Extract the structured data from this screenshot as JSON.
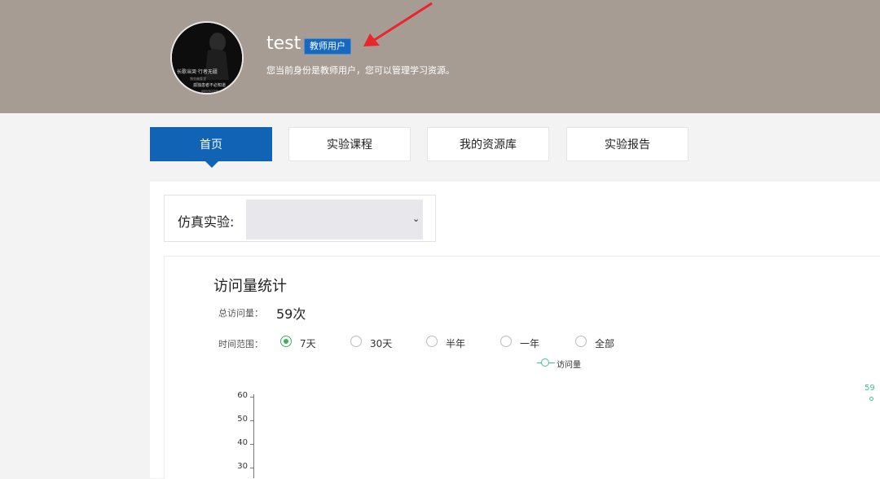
{
  "header": {
    "username": "test",
    "role_badge": "教师用户",
    "role_description": "您当前身份是教师用户，您可以管理学习资源。",
    "avatar_lines": [
      "长歌当哭·行者无疆",
      "独坐幽篁里",
      "孤独患者不必知道",
      "但愿长醉不复醒"
    ]
  },
  "tabs": [
    {
      "label": "首页",
      "active": true
    },
    {
      "label": "实验课程",
      "active": false
    },
    {
      "label": "我的资源库",
      "active": false
    },
    {
      "label": "实验报告",
      "active": false
    }
  ],
  "simulation": {
    "label": "仿真实验:",
    "selected": ""
  },
  "stats": {
    "title": "访问量统计",
    "total_label": "总访问量：",
    "total_value": "59次",
    "range_label": "时间范围：",
    "range_options": [
      {
        "label": "7天",
        "checked": true
      },
      {
        "label": "30天",
        "checked": false
      },
      {
        "label": "半年",
        "checked": false
      },
      {
        "label": "一年",
        "checked": false
      },
      {
        "label": "全部",
        "checked": false
      }
    ]
  },
  "chart_data": {
    "type": "line",
    "series": [
      {
        "name": "访问量",
        "values": [
          59
        ]
      }
    ],
    "point_labels": [
      "59"
    ],
    "y_ticks": [
      "60",
      "50",
      "40",
      "30"
    ],
    "ylim": [
      30,
      60
    ],
    "legend": "top-center",
    "color": "#3dc290"
  },
  "colors": {
    "header_bg": "#a79c94",
    "accent": "#1163b5",
    "radio_checked": "#3dae60"
  }
}
